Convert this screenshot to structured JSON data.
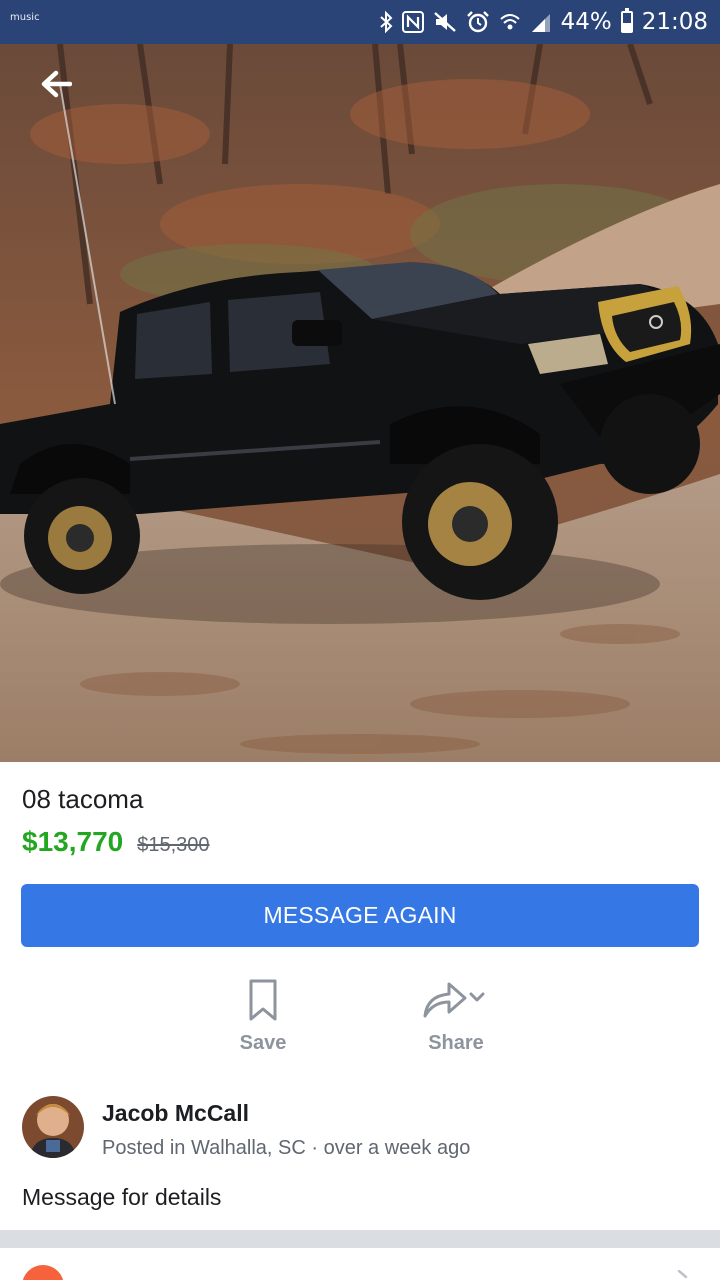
{
  "status_bar": {
    "app_label": "music",
    "battery": "44%",
    "time": "21:08",
    "icons": [
      "bluetooth-icon",
      "nfc-icon",
      "mute-icon",
      "alarm-icon",
      "wifi-icon",
      "signal-icon",
      "battery-icon"
    ]
  },
  "listing": {
    "title": "08 tacoma",
    "price": "$13,770",
    "original_price": "$15,300",
    "message_button": "MESSAGE AGAIN",
    "actions": {
      "save": "Save",
      "share": "Share"
    },
    "description": "Message for details"
  },
  "seller": {
    "name": "Jacob McCall",
    "posted_prefix": "Posted in Walhalla",
    "posted_state": ", SC",
    "posted_time": " · over a week ago"
  },
  "colors": {
    "status_bar": "#2a4477",
    "accent_button": "#3578e5",
    "price_green": "#23a622",
    "muted_text": "#8d949e"
  }
}
